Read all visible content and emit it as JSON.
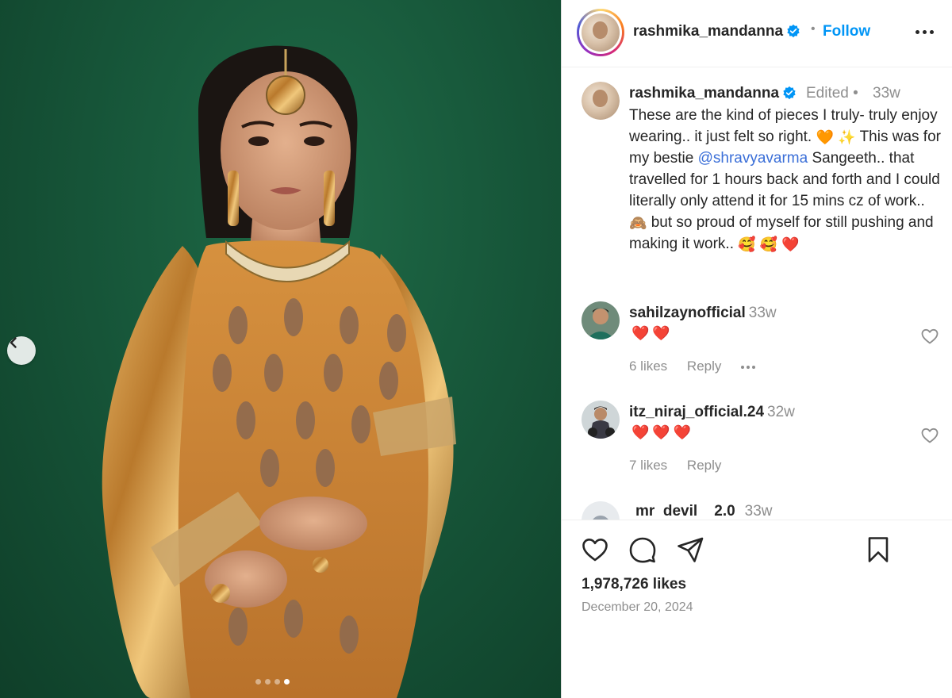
{
  "post": {
    "username": "rashmika_mandanna",
    "follow_label": "Follow",
    "header_separator": "•"
  },
  "caption": {
    "username": "rashmika_mandanna",
    "edited": "Edited •",
    "time": "33w",
    "line1": "These are the kind of pieces I truly- truly enjoy wearing.. it just felt so right.",
    "line2_prefix": "This was for my bestie",
    "mention": "@shravyavarma",
    "line3": "Sangeeth.. that travelled for 1 hours back and forth and I could literally only attend it for 15 mins cz of work..",
    "line4": "but so proud of myself for still pushing and making it work..",
    "emoji_1": "🧡",
    "emoji_2": "✨",
    "emoji_3": "🙈",
    "emoji_4": "🥰 🥰 ❤️"
  },
  "comments": [
    {
      "username": "sahilzaynofficial",
      "time": "33w",
      "text": "❤️❤️",
      "likes": "6 likes",
      "reply": "Reply"
    },
    {
      "username": "itz_niraj_official.24",
      "time": "32w",
      "text": "❤️❤️❤️",
      "likes": "7 likes",
      "reply": "Reply"
    },
    {
      "username": "mr_devil__2.0",
      "display": "mr  devil    2.0",
      "time": "33w"
    }
  ],
  "engagement": {
    "likes": "1,978,726 likes",
    "date": "December 20, 2024"
  },
  "carousel": {
    "total": 4,
    "active": 4
  },
  "colors": {
    "backdrop": "#17573a",
    "outfit": "#c98a3a",
    "link": "#0095f6",
    "heart": "#ed4956"
  }
}
